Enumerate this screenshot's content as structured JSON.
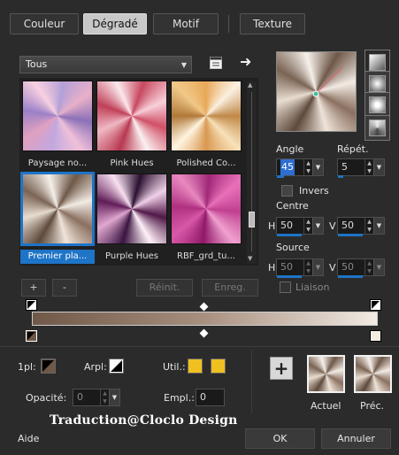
{
  "tabs": [
    "Couleur",
    "Dégradé",
    "Motif",
    "Texture"
  ],
  "category": {
    "selected": "Tous"
  },
  "presets": [
    {
      "label": "Paysage no..."
    },
    {
      "label": "Pink Hues"
    },
    {
      "label": "Polished Co..."
    },
    {
      "label": "Premier pla..."
    },
    {
      "label": "Purple Hues"
    },
    {
      "label": "RBF_grd_tu..."
    }
  ],
  "buttons": {
    "add": "+",
    "remove": "-",
    "reset": "Réinit.",
    "save": "Enreg."
  },
  "angle": {
    "label": "Angle",
    "value": "45"
  },
  "repeat": {
    "label": "Répét.",
    "value": "5"
  },
  "invert": {
    "label": "Invers"
  },
  "center": {
    "label": "Centre",
    "h_label": "H",
    "v_label": "V",
    "h": "50",
    "v": "50"
  },
  "source": {
    "label": "Source",
    "h_label": "H",
    "v_label": "V",
    "h": "50",
    "v": "50"
  },
  "link": {
    "label": "Liaison"
  },
  "stop_controls": {
    "pl_label": "1pl:",
    "arpl_label": "Arpl:",
    "util_label": "Util.:",
    "opacity_label": "Opacité:",
    "opacity": "0",
    "empl_label": "Empl.:",
    "empl": "0"
  },
  "preview": {
    "current_label": "Actuel",
    "previous_label": "Préc."
  },
  "watermark": "Traduction@Cloclo Design",
  "footer": {
    "help": "Aide",
    "ok": "OK",
    "cancel": "Annuler"
  },
  "colors": {
    "accent": "#1e74c6",
    "gold": "#f0c020",
    "gradient_dark": "#6f5848",
    "gradient_light": "#f2ebe4"
  }
}
